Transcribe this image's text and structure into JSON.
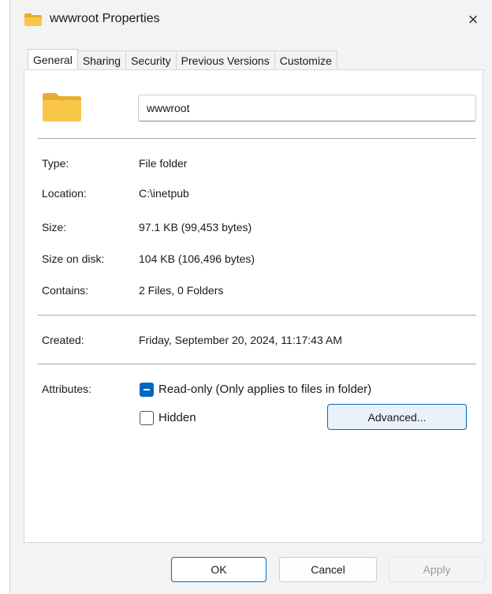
{
  "window": {
    "title": "wwwroot Properties",
    "close_icon": "×"
  },
  "tabs": [
    {
      "label": "General",
      "active": true
    },
    {
      "label": "Sharing",
      "active": false
    },
    {
      "label": "Security",
      "active": false
    },
    {
      "label": "Previous Versions",
      "active": false
    },
    {
      "label": "Customize",
      "active": false
    }
  ],
  "general": {
    "name_value": "wwwroot",
    "type_label": "Type:",
    "type_value": "File folder",
    "location_label": "Location:",
    "location_value": "C:\\inetpub",
    "size_label": "Size:",
    "size_value": "97.1 KB (99,453 bytes)",
    "size_on_disk_label": "Size on disk:",
    "size_on_disk_value": "104 KB (106,496 bytes)",
    "contains_label": "Contains:",
    "contains_value": "2 Files, 0 Folders",
    "created_label": "Created:",
    "created_value": "Friday, September 20, 2024, 11:17:43 AM",
    "attributes_label": "Attributes:",
    "readonly_label": "Read-only (Only applies to files in folder)",
    "readonly_state": "indeterminate",
    "hidden_label": "Hidden",
    "hidden_state": "unchecked",
    "advanced_label": "Advanced..."
  },
  "footer": {
    "ok_label": "OK",
    "cancel_label": "Cancel",
    "apply_label": "Apply"
  },
  "colors": {
    "accent": "#0067c0",
    "folder": "#f8c74a",
    "folder_dark": "#e8ad2a"
  }
}
